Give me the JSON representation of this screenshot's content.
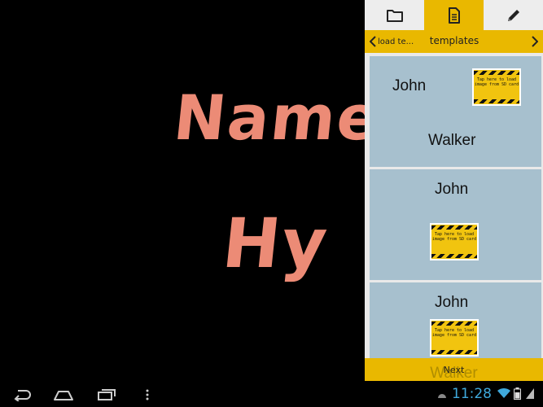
{
  "canvas": {
    "line1": "Name",
    "line2": "Hy",
    "ink_color": "#ec8b76"
  },
  "panel": {
    "tabs": [
      {
        "icon": "folder-icon",
        "active": false
      },
      {
        "icon": "document-icon",
        "active": true
      },
      {
        "icon": "pencil-icon",
        "active": false
      }
    ],
    "nav": {
      "prev_label": "load te...",
      "title": "templates"
    },
    "templates": [
      {
        "first": "John",
        "last": "Walker",
        "thumb_text": "Tap here to load image from SD card"
      },
      {
        "first": "John",
        "thumb_text": "Tap here to load image from SD card"
      },
      {
        "first": "John",
        "thumb_text": "Tap here to load image from SD card"
      }
    ],
    "next_label": "Next",
    "ghost_text": "Walker"
  },
  "status": {
    "time": "11:28"
  },
  "colors": {
    "accent": "#e9b800",
    "card": "#a7c0ce",
    "clock": "#3fa9dc"
  }
}
